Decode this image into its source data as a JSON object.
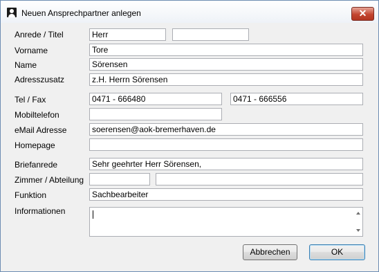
{
  "window": {
    "title": "Neuen Ansprechpartner anlegen",
    "close_symbol": "✕",
    "title_icon": "person-icon"
  },
  "form": {
    "anrede_label": "Anrede / Titel",
    "anrede_value": "Herr",
    "titel_value": "",
    "vorname_label": "Vorname",
    "vorname_value": "Tore",
    "name_label": "Name",
    "name_value": "Sörensen",
    "adresszusatz_label": "Adresszusatz",
    "adresszusatz_value": "z.H. Herrn Sörensen",
    "telfax_label": "Tel / Fax",
    "tel_value": "0471 - 666480",
    "fax_value": "0471 - 666556",
    "mobil_label": "Mobiltelefon",
    "mobil_value": "",
    "email_label": "eMail Adresse",
    "email_value": "soerensen@aok-bremerhaven.de",
    "homepage_label": "Homepage",
    "homepage_value": "",
    "briefanrede_label": "Briefanrede",
    "briefanrede_value": "Sehr geehrter Herr Sörensen,",
    "zimmer_label": "Zimmer / Abteilung",
    "zimmer_value": "",
    "abteilung_value": "",
    "funktion_label": "Funktion",
    "funktion_value": "Sachbearbeiter",
    "informationen_label": "Informationen",
    "informationen_value": ""
  },
  "buttons": {
    "cancel": "Abbrechen",
    "ok": "OK"
  },
  "colors": {
    "dialog_bg": "#f0f0f0",
    "close_button": "#c2452f",
    "field_border": "#abadb3"
  }
}
